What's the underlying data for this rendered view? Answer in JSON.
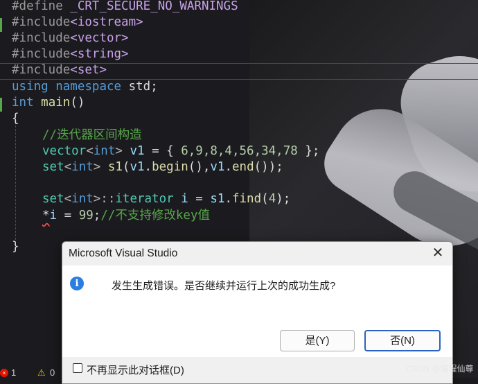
{
  "editor": {
    "lines": {
      "l1": {
        "directive": "#define",
        "rest": " _CRT_SECURE_NO_WARNINGS"
      },
      "l2": {
        "directive": "#include",
        "header": "<iostream>"
      },
      "l3": {
        "directive": "#include",
        "header": "<vector>"
      },
      "l4": {
        "directive": "#include",
        "header": "<string>"
      },
      "l5": {
        "directive": "#include",
        "header": "<set>"
      },
      "l6": {
        "kw1": "using",
        "kw2": "namespace",
        "rest": " std;"
      },
      "l7": {
        "kw": "int",
        "fn": "main",
        "rest": "()"
      },
      "l8": {
        "text": "{"
      },
      "l9": {
        "comment": "//迭代器区间构造"
      },
      "l10": {
        "type": "vector",
        "lt": "<",
        "kw": "int",
        "gt": ">",
        "var": " v1",
        "rest": " = { ",
        "nums": "6,9,8,4,56,34,78",
        "end": " };"
      },
      "l11": {
        "type": "set",
        "lt": "<",
        "kw": "int",
        "gt": ">",
        "fn": " s1",
        "p1": "(",
        "v1": "v1",
        "dot1": ".",
        "f1": "begin",
        "p2": "(),",
        "v2": "v1",
        "dot2": ".",
        "f2": "end",
        "p3": "());"
      },
      "l12": {
        "type": "set",
        "lt": "<",
        "kw": "int",
        "gt": ">::",
        "type2": "iterator",
        "var": " i",
        "eq": " = ",
        "v": "s1",
        "dot": ".",
        "fn": "find",
        "p1": "(",
        "num": "4",
        "p2": ");"
      },
      "l13": {
        "star": "*",
        "var": "i",
        "eq": " = ",
        "num": "99",
        "semi": ";",
        "comment": "//不支持修改key值"
      },
      "l14": {
        "text": "}"
      }
    }
  },
  "dialog": {
    "title": "Microsoft Visual Studio",
    "close_glyph": "✕",
    "info_glyph": "i",
    "message": "发生生成错误。是否继续并运行上次的成功生成?",
    "yes_label": "是(Y)",
    "no_label": "否(N)",
    "checkbox_label": "不再显示此对话框(D)"
  },
  "status": {
    "error_glyph": "×",
    "error_count": "1",
    "warning_glyph": "⚠",
    "warning_count": "0"
  },
  "watermark": "CSDN @编程仙尊",
  "colors": {
    "keyword": "#569cd6",
    "type": "#4ec9b0",
    "comment": "#57a64a",
    "function": "#dcdcaa",
    "include": "#c8a2e8",
    "dialog_accent": "#2b62c4"
  }
}
